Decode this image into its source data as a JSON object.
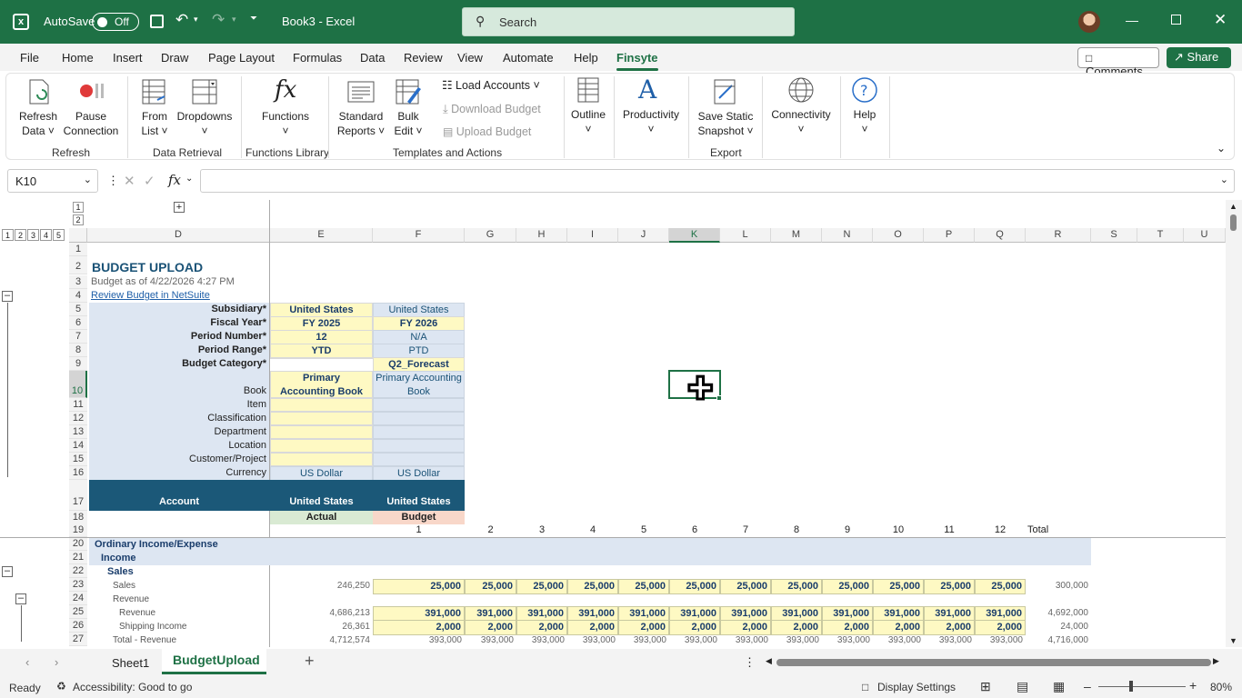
{
  "titlebar": {
    "autosave_label": "AutoSave",
    "autosave_state": "Off",
    "doc_title": "Book3  -  Excel",
    "search_placeholder": "Search"
  },
  "menu": {
    "items": [
      "File",
      "Home",
      "Insert",
      "Draw",
      "Page Layout",
      "Formulas",
      "Data",
      "Review",
      "View",
      "Automate",
      "Help",
      "Finsyte"
    ],
    "comments": "Comments",
    "share": "Share"
  },
  "ribbon": {
    "refresh_data": [
      "Refresh",
      "Data ˅"
    ],
    "pause_connection": [
      "Pause",
      "Connection"
    ],
    "from_list": [
      "From",
      "List ˅"
    ],
    "dropdowns": [
      "Dropdowns",
      "˅"
    ],
    "functions": [
      "Functions",
      "˅"
    ],
    "standard_reports": [
      "Standard",
      "Reports ˅"
    ],
    "bulk_edit": [
      "Bulk",
      "Edit ˅"
    ],
    "load_accounts": "Load Accounts ˅",
    "download_budget": "Download Budget",
    "upload_budget": "Upload Budget",
    "outline": [
      "Outline",
      "˅"
    ],
    "productivity": [
      "Productivity",
      "˅"
    ],
    "save_static": [
      "Save Static",
      "Snapshot ˅"
    ],
    "connectivity": [
      "Connectivity",
      "˅"
    ],
    "help": [
      "Help",
      "˅"
    ],
    "groups": [
      "Refresh",
      "Data Retrieval",
      "Functions Library",
      "Templates and Actions",
      "Export"
    ]
  },
  "formula_bar": {
    "name_box": "K10",
    "fx": "fx",
    "value": ""
  },
  "outline_levels": [
    "1",
    "2"
  ],
  "outline_levels_rows": [
    "1",
    "2",
    "3",
    "4",
    "5"
  ],
  "columns": [
    "D",
    "E",
    "F",
    "G",
    "H",
    "I",
    "J",
    "K",
    "L",
    "M",
    "N",
    "O",
    "P",
    "Q",
    "R",
    "S",
    "T",
    "U"
  ],
  "rows": [
    "1",
    "2",
    "3",
    "4",
    "5",
    "6",
    "7",
    "8",
    "9",
    "10",
    "11",
    "12",
    "13",
    "14",
    "15",
    "16",
    "17",
    "18",
    "19",
    "20",
    "21",
    "22",
    "23",
    "24",
    "25",
    "26",
    "27"
  ],
  "sheet": {
    "title": "BUDGET UPLOAD",
    "subtitle": "Budget as of 4/22/2026 4:27 PM",
    "link": "Review Budget in NetSuite",
    "param_labels": [
      "Subsidiary*",
      "Fiscal Year*",
      "Period Number*",
      "Period Range*",
      "Budget Category*",
      "Book",
      "Item",
      "Classification",
      "Department",
      "Location",
      "Customer/Project",
      "Currency"
    ],
    "col_e": [
      "United States",
      "FY 2025",
      "12",
      "YTD",
      "",
      "Primary Accounting Book",
      "",
      "",
      "",
      "",
      "",
      "US Dollar"
    ],
    "col_f": [
      "United States",
      "FY 2026",
      "N/A",
      "PTD",
      "Q2_Forecast",
      "Primary Accounting Book",
      "",
      "",
      "",
      "",
      "",
      "US Dollar"
    ],
    "account_header": "Account",
    "hdr_e": "United States",
    "hdr_f": "United States",
    "actual": "Actual",
    "budget": "Budget",
    "periods": [
      "1",
      "2",
      "3",
      "4",
      "5",
      "6",
      "7",
      "8",
      "9",
      "10",
      "11",
      "12"
    ],
    "total_label": "Total",
    "sections": {
      "r20": "Ordinary Income/Expense",
      "r21": "Income",
      "r22": "Sales",
      "r24": "Revenue"
    },
    "data_rows": [
      {
        "label": "Sales",
        "actual": "246,250",
        "values": [
          "25,000",
          "25,000",
          "25,000",
          "25,000",
          "25,000",
          "25,000",
          "25,000",
          "25,000",
          "25,000",
          "25,000",
          "25,000",
          "25,000"
        ],
        "total": "300,000"
      },
      {
        "label": "Revenue",
        "actual": "4,686,213",
        "values": [
          "391,000",
          "391,000",
          "391,000",
          "391,000",
          "391,000",
          "391,000",
          "391,000",
          "391,000",
          "391,000",
          "391,000",
          "391,000",
          "391,000"
        ],
        "total": "4,692,000"
      },
      {
        "label": "Shipping Income",
        "actual": "26,361",
        "values": [
          "2,000",
          "2,000",
          "2,000",
          "2,000",
          "2,000",
          "2,000",
          "2,000",
          "2,000",
          "2,000",
          "2,000",
          "2,000",
          "2,000"
        ],
        "total": "24,000"
      },
      {
        "label": "Total - Revenue",
        "actual": "4,712,574",
        "values": [
          "393,000",
          "393,000",
          "393,000",
          "393,000",
          "393,000",
          "393,000",
          "393,000",
          "393,000",
          "393,000",
          "393,000",
          "393,000",
          "393,000"
        ],
        "total": "4,716,000"
      }
    ]
  },
  "tabs": {
    "sheet1": "Sheet1",
    "active": "BudgetUpload"
  },
  "status": {
    "ready": "Ready",
    "accessibility": "Accessibility: Good to go",
    "display_settings": "Display Settings",
    "zoom": "80%"
  }
}
